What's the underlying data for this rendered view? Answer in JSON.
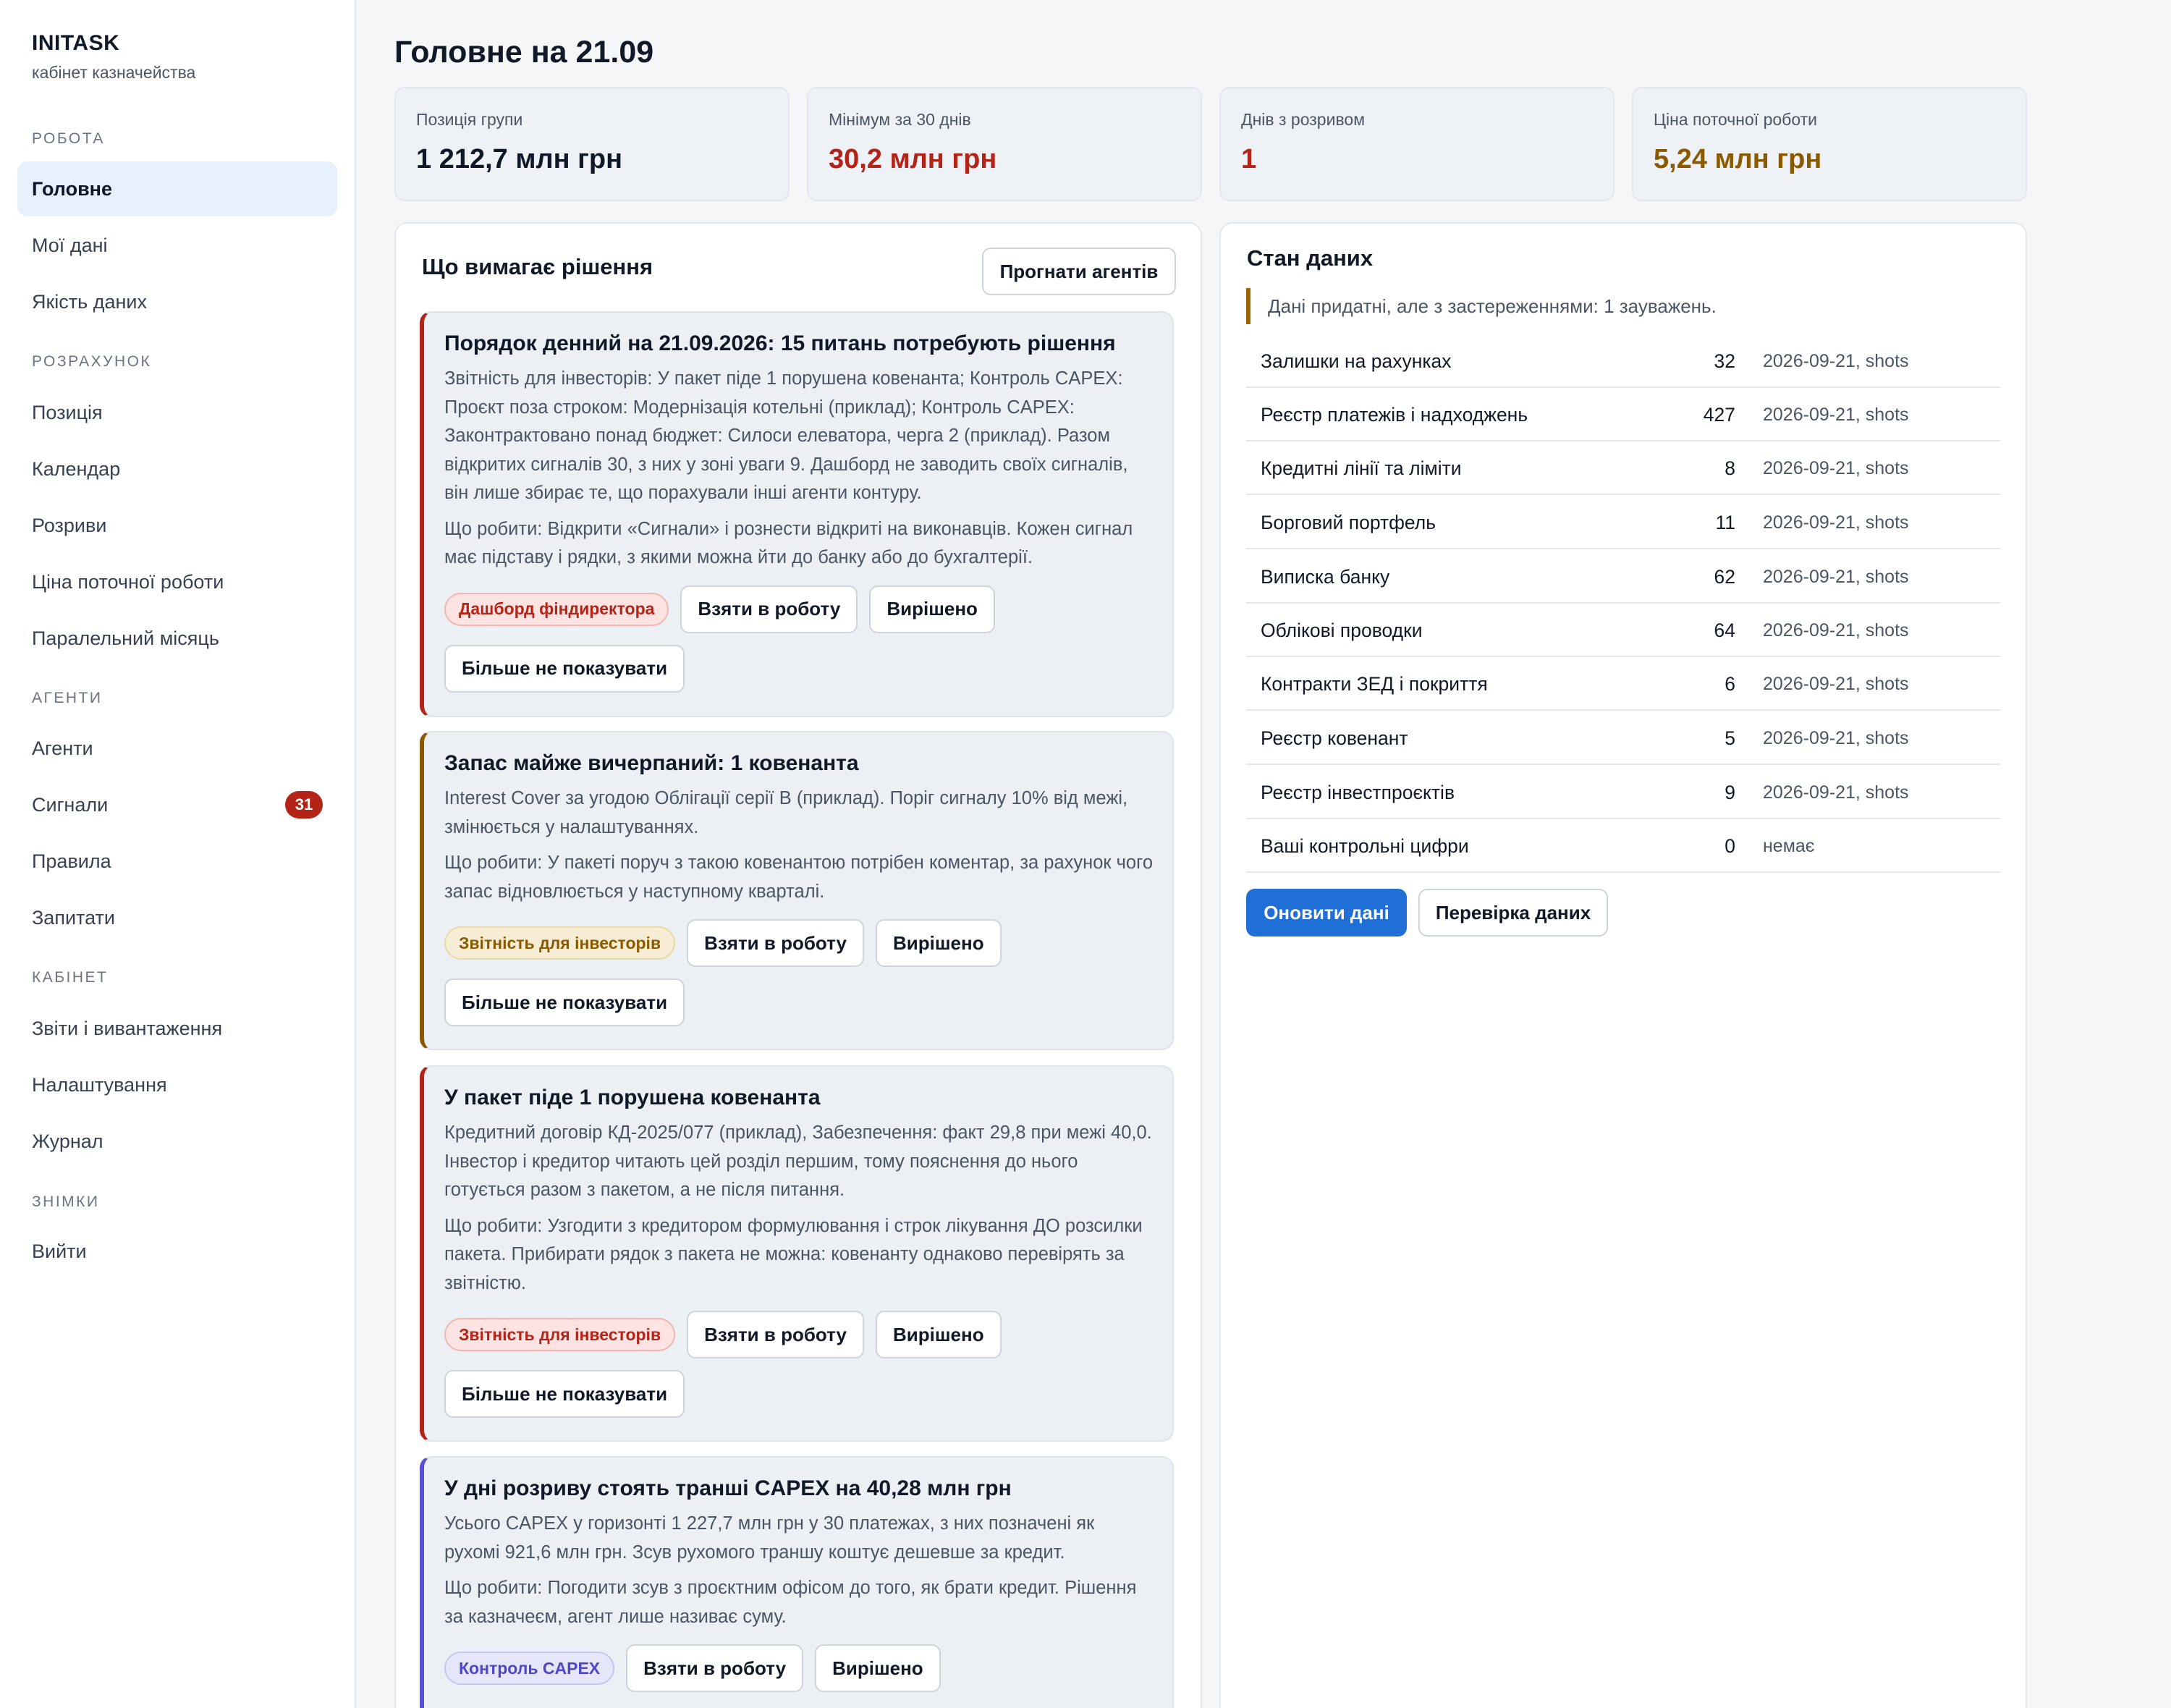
{
  "brand": {
    "name": "INITASK",
    "subtitle": "кабінет казначейства"
  },
  "sidebar": {
    "sections": [
      {
        "title": "РОБОТА",
        "items": [
          {
            "label": "Головне",
            "active": true
          },
          {
            "label": "Мої дані"
          },
          {
            "label": "Якість даних"
          }
        ]
      },
      {
        "title": "РОЗРАХУНОК",
        "items": [
          {
            "label": "Позиція"
          },
          {
            "label": "Календар"
          },
          {
            "label": "Розриви"
          },
          {
            "label": "Ціна поточної роботи"
          },
          {
            "label": "Паралельний місяць"
          }
        ]
      },
      {
        "title": "АГЕНТИ",
        "items": [
          {
            "label": "Агенти"
          },
          {
            "label": "Сигнали",
            "badge": "31"
          },
          {
            "label": "Правила"
          },
          {
            "label": "Запитати"
          }
        ]
      },
      {
        "title": "КАБІНЕТ",
        "items": [
          {
            "label": "Звіти і вивантаження"
          },
          {
            "label": "Налаштування"
          },
          {
            "label": "Журнал"
          }
        ]
      },
      {
        "title": "ЗНІМКИ",
        "items": [
          {
            "label": "Вийти"
          }
        ]
      }
    ]
  },
  "page": {
    "title": "Головне на 21.09"
  },
  "kpis": [
    {
      "label": "Позиція групи",
      "value": "1 212,7 млн грн",
      "color": "#111827"
    },
    {
      "label": "Мінімум за 30 днів",
      "value": "30,2 млн грн",
      "color": "#b42318"
    },
    {
      "label": "Днів з розривом",
      "value": "1",
      "color": "#b42318"
    },
    {
      "label": "Ціна поточної роботи",
      "value": "5,24 млн грн",
      "color": "#8a5a00"
    }
  ],
  "decisions": {
    "title": "Що вимагає рішення",
    "run_agents_label": "Прогнати агентів",
    "take_label": "Взяти в роботу",
    "resolved_label": "Вирішено",
    "hide_label": "Більше не показувати",
    "cards": [
      {
        "title": "Порядок денний на 21.09.2026: 15 питань потребують рішення",
        "text": "Звітність для інвесторів: У пакет піде 1 порушена ковенанта; Контроль CAPEX: Проєкт поза строком: Модернізація котельні (приклад); Контроль CAPEX: Законтрактовано понад бюджет: Силоси елеватора, черга 2 (приклад). Разом відкритих сигналів 30, з них у зоні уваги 9. Дашборд не заводить своїх сигналів, він лише збирає те, що порахували інші агенти контуру.",
        "action": "Що робити: Відкрити «Сигнали» і рознести відкриті на виконавців. Кожен сигнал має підставу і рядки, з якими можна йти до банку або до бухгалтерії.",
        "tag": "Дашборд фіндиректора",
        "tag_style": "red",
        "accent": "#b42318"
      },
      {
        "title": "Запас майже вичерпаний: 1 ковенанта",
        "text": "Interest Cover за угодою Облігації серії B (приклад). Поріг сигналу 10% від межі, змінюється у налаштуваннях.",
        "action": "Що робити: У пакеті поруч з такою ковенантою потрібен коментар, за рахунок чого запас відновлюється у наступному кварталі.",
        "tag": "Звітність для інвесторів",
        "tag_style": "amber",
        "accent": "#8a5a00"
      },
      {
        "title": "У пакет піде 1 порушена ковенанта",
        "text": "Кредитний договір КД-2025/077 (приклад), Забезпечення: факт 29,8 при межі 40,0. Інвестор і кредитор читають цей розділ першим, тому пояснення до нього готується разом з пакетом, а не після питання.",
        "action": "Що робити: Узгодити з кредитором формулювання і строк лікування ДО розсилки пакета. Прибирати рядок з пакета не можна: ковенанту однаково перевірять за звітністю.",
        "tag": "Звітність для інвесторів",
        "tag_style": "red",
        "accent": "#b42318"
      },
      {
        "title": "У дні розриву стоять транші CAPEX на 40,28 млн грн",
        "text": "Усього CAPEX у горизонті 1 227,7 млн грн у 30 платежах, з них позначені як рухомі 921,6 млн грн. Зсув рухомого траншу коштує дешевше за кредит.",
        "action": "Що робити: Погодити зсув з проєктним офісом до того, як брати кредит. Рішення за казначеєм, агент лише називає суму.",
        "tag": "Контроль CAPEX",
        "tag_style": "violet",
        "accent": "#5b4fd6"
      }
    ]
  },
  "data_status": {
    "title": "Стан даних",
    "note": "Дані придатні, але з застереженнями: 1 зауважень.",
    "rows": [
      {
        "name": "Залишки на рахунках",
        "count": "32",
        "source": "2026-09-21, shots"
      },
      {
        "name": "Реєстр платежів і надходжень",
        "count": "427",
        "source": "2026-09-21, shots"
      },
      {
        "name": "Кредитні лінії та ліміти",
        "count": "8",
        "source": "2026-09-21, shots"
      },
      {
        "name": "Борговий портфель",
        "count": "11",
        "source": "2026-09-21, shots"
      },
      {
        "name": "Виписка банку",
        "count": "62",
        "source": "2026-09-21, shots"
      },
      {
        "name": "Облікові проводки",
        "count": "64",
        "source": "2026-09-21, shots"
      },
      {
        "name": "Контракти ЗЕД і покриття",
        "count": "6",
        "source": "2026-09-21, shots"
      },
      {
        "name": "Реєстр ковенант",
        "count": "5",
        "source": "2026-09-21, shots"
      },
      {
        "name": "Реєстр інвестпроєктів",
        "count": "9",
        "source": "2026-09-21, shots"
      },
      {
        "name": "Ваші контрольні цифри",
        "count": "0",
        "source": "немає"
      }
    ],
    "refresh_label": "Оновити дані",
    "check_label": "Перевірка даних"
  }
}
